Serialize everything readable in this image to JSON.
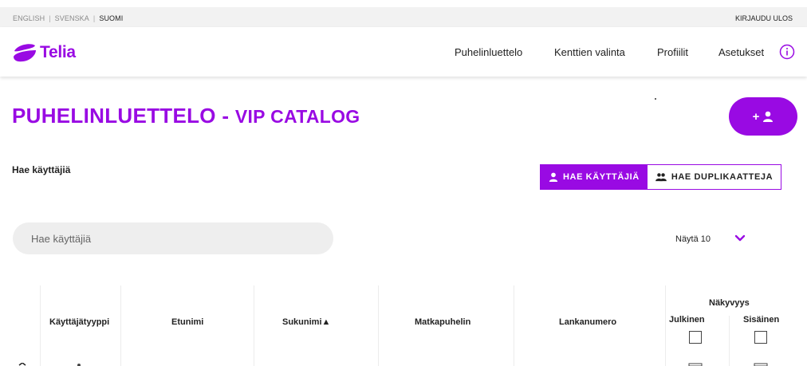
{
  "topbar": {
    "languages": [
      "ENGLISH",
      "SVENSKA",
      "SUOMI"
    ],
    "active_language": "SUOMI",
    "logout_label": "KIRJAUDU ULOS"
  },
  "header": {
    "logo_text": "Telia",
    "nav": [
      "Puhelinluettelo",
      "Kenttien valinta",
      "Profiilit",
      "Asetukset"
    ],
    "info_icon": "info-icon"
  },
  "page": {
    "title": "PUHELINLUETTELO - ",
    "subtitle": "VIP CATALOG",
    "add_user_label": "+"
  },
  "search": {
    "heading": "Hae käyttäjiä",
    "tab_users": "HAE KÄYTTÄJIÄ",
    "tab_duplicates": "HAE DUPLIKAATTEJA",
    "placeholder": "Hae käyttäjiä",
    "show_label": "Näytä 10"
  },
  "table": {
    "columns": [
      "Käyttäjätyyppi",
      "Etunimi",
      "Sukunimi▲",
      "Matkapuhelin",
      "Lankanumero"
    ],
    "visibility_group": "Näkyvyys",
    "visibility_columns": [
      "Julkinen",
      "Sisäinen"
    ]
  },
  "colors": {
    "brand": "#990ae3",
    "topbar_bg": "#f2f2f2",
    "search_bg": "#eeeeee"
  }
}
